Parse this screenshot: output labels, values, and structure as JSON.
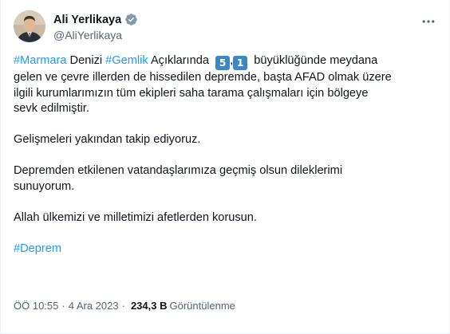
{
  "author": {
    "name": "Ali Yerlikaya",
    "handle": "@AliYerlikaya",
    "verified_icon": "verified-badge-icon",
    "verified_color": "#829aab"
  },
  "tweet": {
    "line1": {
      "tag1": "#Marmara",
      "text1": " Denizi ",
      "tag2": "#Gemlik",
      "text2": " Açıklarında  ",
      "keycap1": "5",
      "comma": ",",
      "keycap2": "1",
      "text3": "  büyüklüğünde meydana"
    },
    "line2": "gelen ve çevre illerden de hissedilen depremde, başta AFAD olmak üzere",
    "line3": "ilgili kurumlarımızın tüm ekipleri saha tarama çalışmaları için bölgeye",
    "line4": "sevk edilmiştir.",
    "para2": "Gelişmeleri yakından takip ediyoruz.",
    "para3_line1": "Depremden etkilenen vatandaşlarımıza geçmiş olsun dileklerimi",
    "para3_line2": "sunuyorum.",
    "para4": "Allah ülkemizi ve milletimizi afetlerden korusun.",
    "hashtag_final": "#Deprem"
  },
  "meta": {
    "time": "ÖÖ 10:55",
    "separator": "·",
    "date": "4 Ara 2023",
    "separator2": "·",
    "views_count": "234,3 B",
    "views_label": "Görüntülenme"
  },
  "colors": {
    "link": "#1d9bf0",
    "text": "#0f1419",
    "muted": "#536471",
    "keycap": "#3b88c3"
  }
}
